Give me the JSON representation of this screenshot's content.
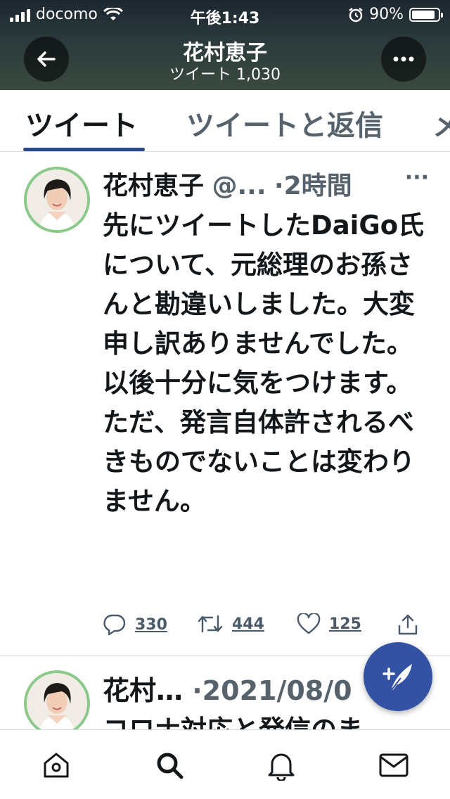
{
  "status_bar": {
    "carrier": "docomo",
    "time": "午後1:43",
    "battery": "90%",
    "battery_level": 0.9
  },
  "header": {
    "title": "花村恵子",
    "subtitle": "ツイート 1,030",
    "back_icon": "arrow-left-icon",
    "more_icon": "ellipsis-icon"
  },
  "tabs": [
    {
      "label": "ツイート",
      "selected": true
    },
    {
      "label": "ツイートと返信",
      "selected": false
    },
    {
      "label": "メ",
      "selected": false
    }
  ],
  "tweets": [
    {
      "name": "花村恵子",
      "handle": "@...",
      "time": "·2時間",
      "more": "···",
      "text": "先にツイートしたDaiGo氏について、元総理のお孫さんと勘違いしました。大変申し訳ありませんでした。以後十分に気をつけます。\nただ、発言自体許されるべきものでないことは変わりません。",
      "replies": "330",
      "retweets": "444",
      "likes": "125"
    },
    {
      "name": "花村…",
      "time": "·2021/08/0",
      "text_preview": "コロナ対応と発信のま"
    }
  ],
  "colors": {
    "accent": "#3452a4",
    "tab_indicator": "#2b4a8a",
    "avatar_ring": "#8bc98a",
    "muted_text": "#56626c"
  },
  "nav": [
    "home-icon",
    "search-icon",
    "bell-icon",
    "mail-icon"
  ]
}
